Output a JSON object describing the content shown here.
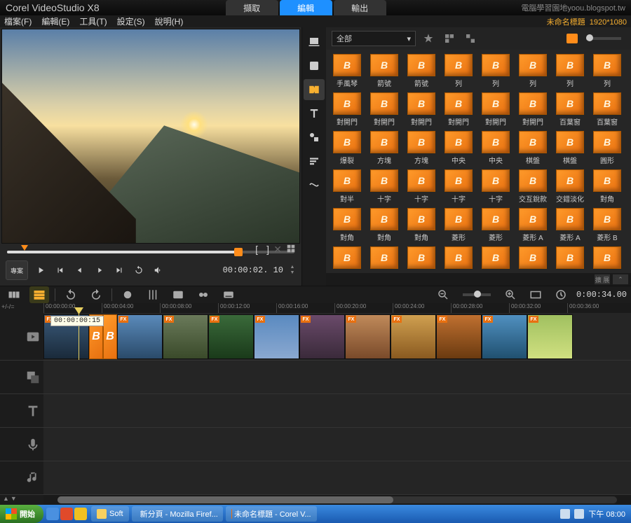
{
  "app_title": "Corel VideoStudio X8",
  "watermark": "電腦學習園地yoou.blogspot.tw",
  "mode_tabs": {
    "capture": "擷取",
    "edit": "編輯",
    "share": "輸出",
    "active": "edit"
  },
  "menu": {
    "file": "檔案(F)",
    "edit": "編輯(E)",
    "tool": "工具(T)",
    "settings": "設定(S)",
    "help": "說明(H)"
  },
  "project": {
    "name": "未命名標題",
    "dims": "1920*1080"
  },
  "preview": {
    "mode_label": "專案",
    "timecode": "00:00:02. 10",
    "tooltip": "00:00:00:15"
  },
  "library": {
    "category": "全部",
    "footer": {
      "expand": "擴 展",
      "collapse": "⌃"
    },
    "items": [
      "手風琴",
      "箭號",
      "箭號",
      "列",
      "列",
      "列",
      "列",
      "列",
      "對開門",
      "對開門",
      "對開門",
      "對開門",
      "對開門",
      "對開門",
      "百葉窗",
      "百葉窗",
      "爆裂",
      "方塊",
      "方塊",
      "中央",
      "中央",
      "棋盤",
      "棋盤",
      "圓形",
      "對半",
      "十字",
      "十字",
      "十字",
      "十字",
      "交互銳款",
      "交錯淡化",
      "對角",
      "對角",
      "對角",
      "對角",
      "菱形",
      "菱形",
      "菱形 A",
      "菱形 A",
      "菱形 B"
    ],
    "glyph": "B"
  },
  "timeline": {
    "view_mode_label": "+/-/=",
    "duration": "0:00:34.00",
    "ruler": [
      "00:00:00:00",
      "00:00:04:00",
      "00:00:08:00",
      "00:00:12:00",
      "00:00:16:00",
      "00:00:20:00",
      "00:00:24:00",
      "00:00:28:00",
      "00:00:32:00",
      "00:00:36:00"
    ],
    "clips": [
      {
        "fx": true,
        "cls": "c1"
      },
      {
        "trans": true
      },
      {
        "trans": true
      },
      {
        "fx": true,
        "cls": "c2"
      },
      {
        "fx": true,
        "cls": "c3"
      },
      {
        "fx": true,
        "cls": "c4"
      },
      {
        "fx": true,
        "cls": "c5"
      },
      {
        "fx": true,
        "cls": "c6"
      },
      {
        "fx": true,
        "cls": "c7"
      },
      {
        "fx": true,
        "cls": "c8"
      },
      {
        "fx": true,
        "cls": "c9"
      },
      {
        "fx": true,
        "cls": "c10"
      },
      {
        "fx": true,
        "cls": "c11"
      }
    ],
    "fx_label": "FX"
  },
  "taskbar": {
    "start": "開始",
    "tasks": [
      {
        "label": "Soft",
        "color": "#f8d060"
      },
      {
        "label": "新分頁 - Mozilla Firef...",
        "color": "#ff7a2a"
      },
      {
        "label": "未命名標題 - Corel V...",
        "color": "#e87010"
      }
    ],
    "clock": "下午 08:00"
  }
}
